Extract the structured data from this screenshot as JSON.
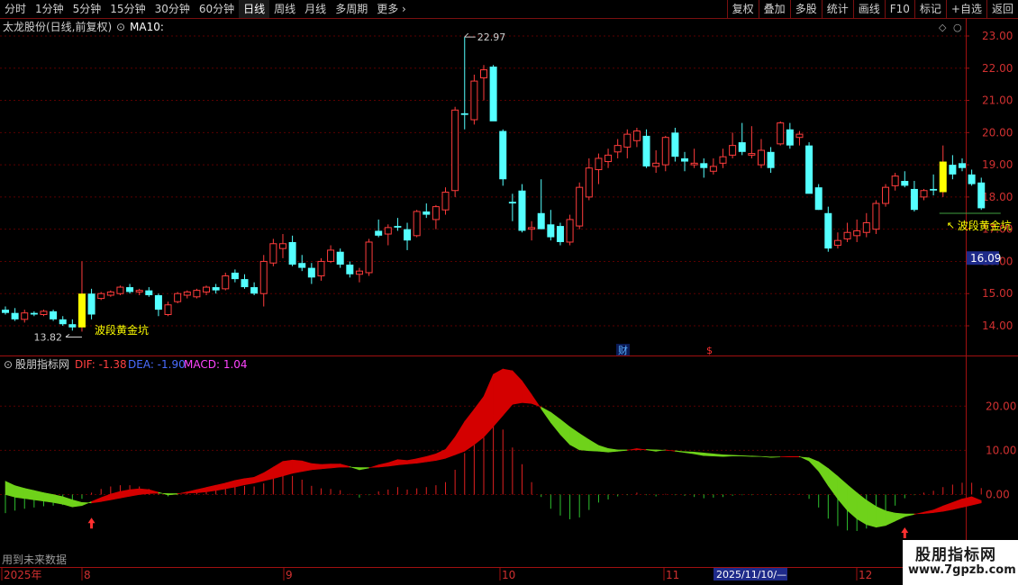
{
  "toolbar": {
    "periods": [
      "分时",
      "1分钟",
      "5分钟",
      "15分钟",
      "30分钟",
      "60分钟",
      "日线",
      "周线",
      "月线",
      "多周期",
      "更多"
    ],
    "active": "日线",
    "right_buttons": [
      "复权",
      "叠加",
      "多股",
      "统计",
      "画线",
      "F10",
      "标记",
      "+自选",
      "返回"
    ]
  },
  "main": {
    "title": "太龙股份(日线,前复权)",
    "ma_label": "MA10:",
    "price_axis": [
      "23.00",
      "22.00",
      "21.00",
      "20.00",
      "19.00",
      "18.00",
      "17.00",
      "16.00",
      "15.00",
      "14.00"
    ],
    "current_price": "16.09",
    "high_label": "22.97",
    "low_label": "13.82",
    "signal_label_1": "波段黄金坑",
    "signal_label_2": "波段黄金坑",
    "marker_cai": "财",
    "marker_dollar": "$"
  },
  "indicator": {
    "name": "股朋指标网",
    "dif_label": "DIF: -1.38",
    "dea_label": "DEA: -1.90",
    "macd_label": "MACD: 1.04",
    "axis": [
      "20.00",
      "10.00",
      "0.00"
    ]
  },
  "bottom": {
    "future_data": "用到未来数据",
    "dates": [
      "2025年",
      "8",
      "9",
      "10",
      "11",
      "12"
    ],
    "cursor_date": "2025/11/10/—"
  },
  "watermark": {
    "title": "股朋指标网",
    "url": "www.7gpzb.com"
  },
  "colors": {
    "up": "#ff3c3c",
    "down": "#54ffff",
    "signal": "#ffff00",
    "macd_red": "#d40000",
    "macd_green": "#6fd21a",
    "grid": "#5a0000"
  },
  "chart_data": {
    "type": "candlestick",
    "ylim": [
      13.5,
      23.3
    ],
    "candles": [
      {
        "o": 14.5,
        "h": 14.6,
        "l": 14.35,
        "c": 14.4
      },
      {
        "o": 14.4,
        "h": 14.55,
        "l": 14.15,
        "c": 14.2
      },
      {
        "o": 14.2,
        "h": 14.5,
        "l": 14.1,
        "c": 14.4
      },
      {
        "o": 14.4,
        "h": 14.45,
        "l": 14.3,
        "c": 14.35
      },
      {
        "o": 14.35,
        "h": 14.5,
        "l": 14.3,
        "c": 14.45
      },
      {
        "o": 14.45,
        "h": 14.5,
        "l": 14.15,
        "c": 14.2
      },
      {
        "o": 14.2,
        "h": 14.3,
        "l": 14.0,
        "c": 14.05
      },
      {
        "o": 14.05,
        "h": 14.2,
        "l": 13.85,
        "c": 13.95
      },
      {
        "o": 13.95,
        "h": 16.0,
        "l": 13.82,
        "c": 15.0
      },
      {
        "o": 15.0,
        "h": 15.15,
        "l": 14.2,
        "c": 14.35
      },
      {
        "o": 14.85,
        "h": 15.05,
        "l": 14.8,
        "c": 15.0
      },
      {
        "o": 14.95,
        "h": 15.1,
        "l": 14.9,
        "c": 15.05
      },
      {
        "o": 15.0,
        "h": 15.25,
        "l": 14.95,
        "c": 15.2
      },
      {
        "o": 15.2,
        "h": 15.3,
        "l": 15.0,
        "c": 15.05
      },
      {
        "o": 15.05,
        "h": 15.15,
        "l": 14.95,
        "c": 15.1
      },
      {
        "o": 15.1,
        "h": 15.2,
        "l": 14.9,
        "c": 14.95
      },
      {
        "o": 14.95,
        "h": 15.0,
        "l": 14.3,
        "c": 14.5
      },
      {
        "o": 14.35,
        "h": 14.75,
        "l": 14.3,
        "c": 14.65
      },
      {
        "o": 14.75,
        "h": 15.05,
        "l": 14.7,
        "c": 15.0
      },
      {
        "o": 14.95,
        "h": 15.1,
        "l": 14.85,
        "c": 15.05
      },
      {
        "o": 14.9,
        "h": 15.15,
        "l": 14.85,
        "c": 15.1
      },
      {
        "o": 15.05,
        "h": 15.25,
        "l": 14.95,
        "c": 15.2
      },
      {
        "o": 15.2,
        "h": 15.3,
        "l": 15.0,
        "c": 15.1
      },
      {
        "o": 15.15,
        "h": 15.65,
        "l": 15.1,
        "c": 15.55
      },
      {
        "o": 15.65,
        "h": 15.75,
        "l": 15.35,
        "c": 15.45
      },
      {
        "o": 15.45,
        "h": 15.6,
        "l": 15.15,
        "c": 15.2
      },
      {
        "o": 15.2,
        "h": 15.35,
        "l": 14.95,
        "c": 15.0
      },
      {
        "o": 15.0,
        "h": 16.2,
        "l": 14.6,
        "c": 16.0
      },
      {
        "o": 15.95,
        "h": 16.7,
        "l": 15.85,
        "c": 16.55
      },
      {
        "o": 16.4,
        "h": 16.85,
        "l": 16.1,
        "c": 16.55
      },
      {
        "o": 16.6,
        "h": 16.8,
        "l": 15.85,
        "c": 15.9
      },
      {
        "o": 15.95,
        "h": 16.2,
        "l": 15.7,
        "c": 15.8
      },
      {
        "o": 15.8,
        "h": 15.95,
        "l": 15.3,
        "c": 15.5
      },
      {
        "o": 15.55,
        "h": 16.1,
        "l": 15.4,
        "c": 16.0
      },
      {
        "o": 16.0,
        "h": 16.5,
        "l": 15.95,
        "c": 16.35
      },
      {
        "o": 16.3,
        "h": 16.4,
        "l": 15.8,
        "c": 15.9
      },
      {
        "o": 15.9,
        "h": 16.0,
        "l": 15.5,
        "c": 15.6
      },
      {
        "o": 15.6,
        "h": 15.8,
        "l": 15.35,
        "c": 15.7
      },
      {
        "o": 15.65,
        "h": 16.7,
        "l": 15.55,
        "c": 16.6
      },
      {
        "o": 16.95,
        "h": 17.3,
        "l": 16.75,
        "c": 16.8
      },
      {
        "o": 16.85,
        "h": 17.15,
        "l": 16.5,
        "c": 17.05
      },
      {
        "o": 17.1,
        "h": 17.35,
        "l": 16.95,
        "c": 17.05
      },
      {
        "o": 17.0,
        "h": 17.2,
        "l": 16.35,
        "c": 16.65
      },
      {
        "o": 16.8,
        "h": 17.6,
        "l": 16.75,
        "c": 17.55
      },
      {
        "o": 17.55,
        "h": 17.8,
        "l": 17.35,
        "c": 17.45
      },
      {
        "o": 17.3,
        "h": 17.75,
        "l": 17.0,
        "c": 17.7
      },
      {
        "o": 17.6,
        "h": 18.3,
        "l": 17.45,
        "c": 18.15
      },
      {
        "o": 18.2,
        "h": 20.8,
        "l": 18.0,
        "c": 20.7
      },
      {
        "o": 20.6,
        "h": 22.97,
        "l": 20.1,
        "c": 20.55
      },
      {
        "o": 20.4,
        "h": 21.8,
        "l": 20.25,
        "c": 21.6
      },
      {
        "o": 21.7,
        "h": 22.1,
        "l": 21.0,
        "c": 21.95
      },
      {
        "o": 22.05,
        "h": 22.1,
        "l": 20.4,
        "c": 20.35
      },
      {
        "o": 20.05,
        "h": 20.1,
        "l": 18.35,
        "c": 18.55
      },
      {
        "o": 17.85,
        "h": 18.1,
        "l": 17.25,
        "c": 17.8
      },
      {
        "o": 18.2,
        "h": 18.4,
        "l": 16.9,
        "c": 16.95
      },
      {
        "o": 17.0,
        "h": 17.25,
        "l": 16.65,
        "c": 17.05
      },
      {
        "o": 17.5,
        "h": 18.55,
        "l": 17.05,
        "c": 17.0
      },
      {
        "o": 17.15,
        "h": 17.6,
        "l": 16.65,
        "c": 16.75
      },
      {
        "o": 17.1,
        "h": 17.2,
        "l": 16.5,
        "c": 16.6
      },
      {
        "o": 16.6,
        "h": 17.45,
        "l": 16.5,
        "c": 17.3
      },
      {
        "o": 17.1,
        "h": 18.45,
        "l": 17.0,
        "c": 18.3
      },
      {
        "o": 18.0,
        "h": 19.2,
        "l": 17.9,
        "c": 18.9
      },
      {
        "o": 18.85,
        "h": 19.35,
        "l": 18.4,
        "c": 19.2
      },
      {
        "o": 19.1,
        "h": 19.5,
        "l": 18.9,
        "c": 19.3
      },
      {
        "o": 19.4,
        "h": 19.8,
        "l": 19.2,
        "c": 19.6
      },
      {
        "o": 19.55,
        "h": 20.1,
        "l": 19.2,
        "c": 19.95
      },
      {
        "o": 19.75,
        "h": 20.15,
        "l": 19.55,
        "c": 20.05
      },
      {
        "o": 19.9,
        "h": 20.1,
        "l": 18.9,
        "c": 18.95
      },
      {
        "o": 18.95,
        "h": 19.45,
        "l": 18.75,
        "c": 19.05
      },
      {
        "o": 19.0,
        "h": 19.9,
        "l": 18.8,
        "c": 19.85
      },
      {
        "o": 20.0,
        "h": 20.15,
        "l": 19.1,
        "c": 19.25
      },
      {
        "o": 19.2,
        "h": 19.4,
        "l": 18.8,
        "c": 19.1
      },
      {
        "o": 19.0,
        "h": 19.5,
        "l": 18.9,
        "c": 19.05
      },
      {
        "o": 19.05,
        "h": 19.2,
        "l": 18.6,
        "c": 18.9
      },
      {
        "o": 18.8,
        "h": 19.2,
        "l": 18.7,
        "c": 18.95
      },
      {
        "o": 19.05,
        "h": 19.5,
        "l": 18.9,
        "c": 19.25
      },
      {
        "o": 19.3,
        "h": 20.0,
        "l": 19.2,
        "c": 19.6
      },
      {
        "o": 19.7,
        "h": 20.3,
        "l": 19.3,
        "c": 19.4
      },
      {
        "o": 19.3,
        "h": 20.2,
        "l": 19.2,
        "c": 19.35
      },
      {
        "o": 19.0,
        "h": 19.8,
        "l": 18.9,
        "c": 19.45
      },
      {
        "o": 19.4,
        "h": 19.55,
        "l": 18.75,
        "c": 18.9
      },
      {
        "o": 19.65,
        "h": 20.35,
        "l": 19.6,
        "c": 20.3
      },
      {
        "o": 20.1,
        "h": 20.3,
        "l": 19.5,
        "c": 19.6
      },
      {
        "o": 19.85,
        "h": 20.05,
        "l": 19.6,
        "c": 19.95
      },
      {
        "o": 19.6,
        "h": 19.7,
        "l": 18.2,
        "c": 18.1
      },
      {
        "o": 18.3,
        "h": 18.4,
        "l": 17.6,
        "c": 17.6
      },
      {
        "o": 17.5,
        "h": 17.7,
        "l": 16.3,
        "c": 16.4
      },
      {
        "o": 16.5,
        "h": 16.9,
        "l": 16.4,
        "c": 16.65
      },
      {
        "o": 16.7,
        "h": 17.2,
        "l": 16.6,
        "c": 16.9
      },
      {
        "o": 16.8,
        "h": 17.3,
        "l": 16.6,
        "c": 16.95
      },
      {
        "o": 16.9,
        "h": 17.5,
        "l": 16.75,
        "c": 17.2
      },
      {
        "o": 17.0,
        "h": 17.9,
        "l": 16.85,
        "c": 17.8
      },
      {
        "o": 17.8,
        "h": 18.4,
        "l": 17.7,
        "c": 18.3
      },
      {
        "o": 18.35,
        "h": 18.75,
        "l": 18.2,
        "c": 18.65
      },
      {
        "o": 18.5,
        "h": 18.8,
        "l": 18.3,
        "c": 18.35
      },
      {
        "o": 18.25,
        "h": 18.5,
        "l": 17.55,
        "c": 17.6
      },
      {
        "o": 18.0,
        "h": 18.25,
        "l": 17.9,
        "c": 18.2
      },
      {
        "o": 18.25,
        "h": 18.7,
        "l": 18.05,
        "c": 18.2
      },
      {
        "o": 18.15,
        "h": 19.6,
        "l": 18.0,
        "c": 19.1
      },
      {
        "o": 19.0,
        "h": 19.3,
        "l": 18.55,
        "c": 18.7
      },
      {
        "o": 19.05,
        "h": 19.2,
        "l": 18.8,
        "c": 18.9
      },
      {
        "o": 18.7,
        "h": 18.85,
        "l": 18.35,
        "c": 18.4
      },
      {
        "o": 18.45,
        "h": 18.6,
        "l": 17.6,
        "c": 17.65
      }
    ],
    "signal_candles": [
      8,
      98
    ],
    "macd": {
      "ylim": [
        -16,
        28
      ],
      "dif": [
        0.0,
        -0.6,
        -0.9,
        -1.2,
        -1.5,
        -1.8,
        -2.2,
        -2.8,
        -2.5,
        -1.6,
        -0.7,
        0.1,
        0.7,
        1.1,
        1.3,
        1.1,
        0.5,
        -0.1,
        0.1,
        0.6,
        1.1,
        1.6,
        2.1,
        2.6,
        3.2,
        3.6,
        3.9,
        4.9,
        6.2,
        7.5,
        7.8,
        7.6,
        7.0,
        6.8,
        6.9,
        6.9,
        6.3,
        5.6,
        6.0,
        6.7,
        7.2,
        7.9,
        7.7,
        8.1,
        8.6,
        9.2,
        10.2,
        13.0,
        16.5,
        19.3,
        22.2,
        27.2,
        28.4,
        28.0,
        25.7,
        22.6,
        19.4,
        16.3,
        13.6,
        11.3,
        10.1,
        9.9,
        9.8,
        9.6,
        9.8,
        10.0,
        10.4,
        10.1,
        9.8,
        10.1,
        9.8,
        9.5,
        9.2,
        8.8,
        8.7,
        8.6,
        8.7,
        8.7,
        8.6,
        8.6,
        8.4,
        8.5,
        8.6,
        8.6,
        7.6,
        5.3,
        2.0,
        -1.0,
        -3.6,
        -5.5,
        -6.8,
        -7.4,
        -7.0,
        -6.0,
        -5.0,
        -4.5,
        -4.0,
        -3.5,
        -2.6,
        -1.8,
        -1.0,
        -0.5,
        -1.38
      ],
      "dea": [
        3.0,
        2.0,
        1.4,
        0.9,
        0.4,
        0.0,
        -0.5,
        -1.2,
        -1.8,
        -1.9,
        -1.6,
        -1.2,
        -0.8,
        -0.4,
        0.0,
        0.2,
        0.3,
        0.2,
        0.2,
        0.3,
        0.4,
        0.6,
        0.9,
        1.3,
        1.7,
        2.2,
        2.6,
        3.1,
        3.6,
        4.2,
        4.8,
        5.2,
        5.6,
        5.8,
        6.0,
        6.2,
        6.2,
        6.1,
        6.1,
        6.2,
        6.4,
        6.7,
        6.9,
        7.1,
        7.4,
        7.7,
        8.2,
        9.0,
        9.8,
        11.3,
        13.0,
        15.4,
        17.9,
        20.4,
        20.8,
        20.6,
        19.8,
        18.6,
        17.0,
        15.3,
        13.8,
        12.4,
        11.1,
        10.4,
        10.1,
        10.1,
        10.1,
        10.2,
        10.1,
        10.0,
        9.9,
        9.7,
        9.6,
        9.4,
        9.2,
        9.0,
        8.9,
        8.8,
        8.7,
        8.6,
        8.5,
        8.5,
        8.5,
        8.5,
        8.3,
        7.4,
        5.9,
        4.1,
        2.2,
        0.4,
        -1.3,
        -2.7,
        -3.7,
        -4.2,
        -4.4,
        -4.4,
        -4.3,
        -4.1,
        -3.8,
        -3.4,
        -2.9,
        -2.4,
        -1.9
      ],
      "hist": [
        -3.0,
        -2.6,
        -2.3,
        -2.1,
        -1.9,
        -1.8,
        -1.7,
        -1.6,
        -0.7,
        0.3,
        0.9,
        1.3,
        1.5,
        1.5,
        1.3,
        0.9,
        0.2,
        -0.3,
        -0.1,
        0.3,
        0.7,
        1.0,
        1.2,
        1.3,
        1.5,
        1.4,
        1.3,
        1.8,
        2.6,
        3.3,
        3.0,
        2.4,
        1.4,
        1.0,
        0.9,
        0.7,
        0.1,
        -0.5,
        -0.1,
        0.5,
        0.8,
        1.2,
        0.8,
        1.0,
        1.2,
        1.5,
        2.0,
        4.0,
        6.7,
        8.0,
        9.2,
        11.8,
        10.5,
        7.6,
        4.9,
        2.0,
        -0.4,
        -2.3,
        -3.4,
        -4.0,
        -3.7,
        -2.5,
        -1.3,
        -0.8,
        -0.3,
        -0.1,
        0.3,
        -0.1,
        -0.3,
        0.1,
        -0.1,
        -0.2,
        -0.4,
        -0.6,
        -0.5,
        -0.4,
        -0.2,
        -0.1,
        -0.1,
        0.0,
        -0.1,
        0.0,
        0.1,
        0.1,
        -0.7,
        -2.1,
        -3.9,
        -5.1,
        -5.8,
        -5.9,
        -5.5,
        -4.7,
        -3.3,
        -1.8,
        -0.6,
        -0.1,
        0.3,
        0.6,
        1.2,
        1.6,
        1.9,
        1.9,
        1.04
      ]
    }
  }
}
